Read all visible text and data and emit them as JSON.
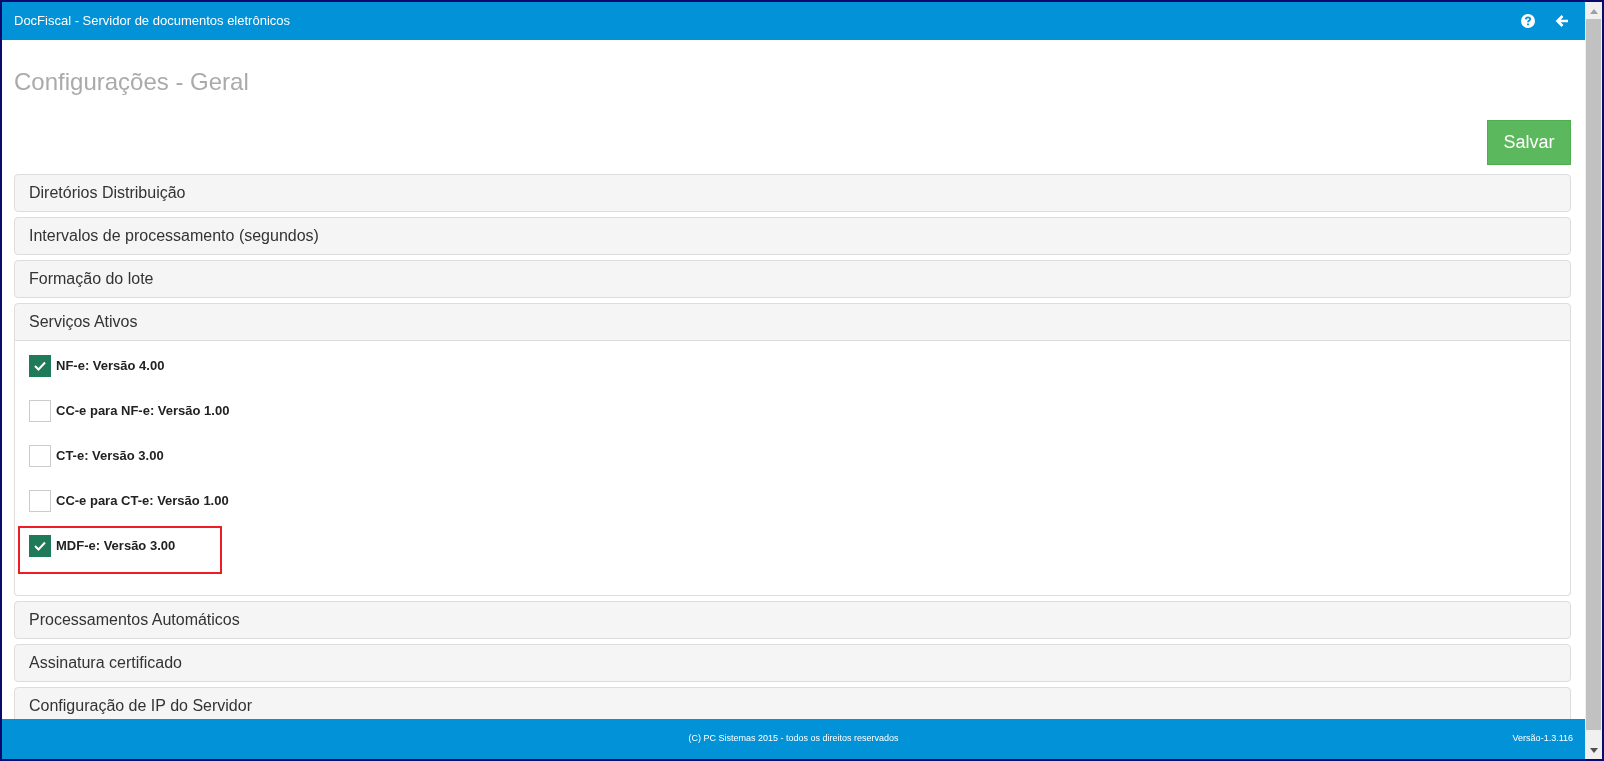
{
  "window": {
    "title": "DocFiscal - Servidor de documentos eletrônicos"
  },
  "page_title": "Configurações - Geral",
  "save_button": "Salvar",
  "panels": [
    {
      "title": "Diretórios Distribuição",
      "expanded": false
    },
    {
      "title": "Intervalos de processamento (segundos)",
      "expanded": false
    },
    {
      "title": "Formação do lote",
      "expanded": false
    },
    {
      "title": "Serviços Ativos",
      "expanded": true,
      "options": [
        {
          "label": "NF-e: Versão 4.00",
          "checked": true,
          "highlighted": false
        },
        {
          "label": "CC-e para NF-e: Versão 1.00",
          "checked": false,
          "highlighted": false
        },
        {
          "label": "CT-e: Versão 3.00",
          "checked": false,
          "highlighted": false
        },
        {
          "label": "CC-e para CT-e: Versão 1.00",
          "checked": false,
          "highlighted": false
        },
        {
          "label": "MDF-e: Versão 3.00",
          "checked": true,
          "highlighted": true
        }
      ]
    },
    {
      "title": "Processamentos Automáticos",
      "expanded": false
    },
    {
      "title": "Assinatura certificado",
      "expanded": false
    },
    {
      "title": "Configuração de IP do Servidor",
      "expanded": false
    }
  ],
  "status_bar": {
    "copyright": "(C) PC Sistemas 2015 - todos os direitos reservados",
    "version": "Versão-1.3.116"
  }
}
